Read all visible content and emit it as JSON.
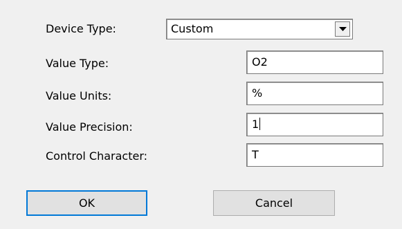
{
  "device_type": {
    "label": "Device Type:",
    "selected": "Custom"
  },
  "fields": {
    "value_type": {
      "label": "Value Type:",
      "value": "O2"
    },
    "value_units": {
      "label": "Value Units:",
      "value": "%"
    },
    "value_precision": {
      "label": "Value Precision:",
      "value": "1"
    },
    "control_character": {
      "label": "Control Character:",
      "value": "T"
    }
  },
  "buttons": {
    "ok": "OK",
    "cancel": "Cancel"
  },
  "icons": {
    "dropdown": "chevron-down-icon"
  }
}
